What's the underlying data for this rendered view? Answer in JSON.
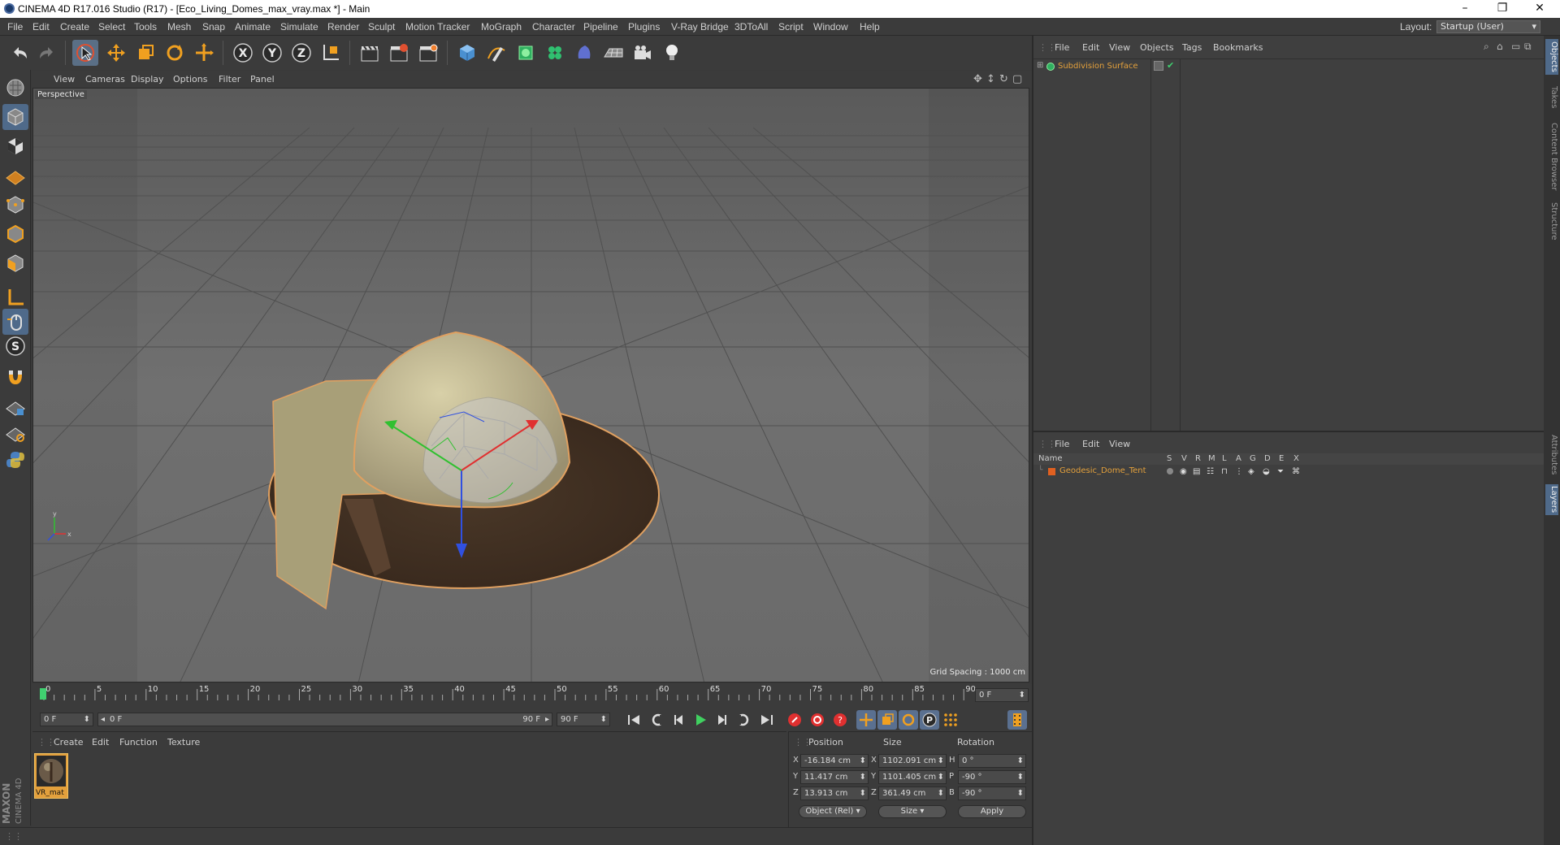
{
  "window": {
    "title": "CINEMA 4D R17.016 Studio (R17) - [Eco_Living_Domes_max_vray.max *] - Main",
    "minimize": "–",
    "restore": "❐",
    "close": "✕"
  },
  "menu": [
    "File",
    "Edit",
    "Create",
    "Select",
    "Tools",
    "Mesh",
    "Snap",
    "Animate",
    "Simulate",
    "Render",
    "Sculpt",
    "Motion Tracker",
    "MoGraph",
    "Character",
    "Pipeline",
    "Plugins",
    "V-Ray Bridge",
    "3DToAll",
    "Script",
    "Window",
    "Help"
  ],
  "layout": {
    "label": "Layout:",
    "value": "Startup (User)"
  },
  "viewport": {
    "menu": [
      "View",
      "Cameras",
      "Display",
      "Options",
      "Filter",
      "Panel"
    ],
    "label": "Perspective",
    "grid_spacing": "Grid Spacing : 1000 cm"
  },
  "timeline": {
    "ticks": [
      "0",
      "5",
      "10",
      "15",
      "20",
      "25",
      "30",
      "35",
      "40",
      "45",
      "50",
      "55",
      "60",
      "65",
      "70",
      "75",
      "80",
      "85",
      "90"
    ],
    "current_frame": "0 F"
  },
  "transport": {
    "start": "0 F",
    "range_start": "0 F",
    "range_end": "90 F",
    "end": "90 F"
  },
  "materials": {
    "menu": [
      "Create",
      "Edit",
      "Function",
      "Texture"
    ],
    "items": [
      {
        "name": "VR_mat"
      }
    ]
  },
  "coordinates": {
    "headers": {
      "position": "Position",
      "size": "Size",
      "rotation": "Rotation"
    },
    "rows": [
      {
        "axis": "X",
        "pos": "-16.184 cm",
        "size_axis": "X",
        "size": "1102.091 cm",
        "rot_axis": "H",
        "rot": "0 °"
      },
      {
        "axis": "Y",
        "pos": "11.417 cm",
        "size_axis": "Y",
        "size": "1101.405 cm",
        "rot_axis": "P",
        "rot": "-90 °"
      },
      {
        "axis": "Z",
        "pos": "13.913 cm",
        "size_axis": "Z",
        "size": "361.49 cm",
        "rot_axis": "B",
        "rot": "-90 °"
      }
    ],
    "mode": "Object (Rel)",
    "size_mode": "Size",
    "apply": "Apply"
  },
  "objects_panel": {
    "menu": [
      "File",
      "Edit",
      "View",
      "Objects",
      "Tags",
      "Bookmarks"
    ],
    "items": [
      {
        "name": "Subdivision Surface"
      }
    ]
  },
  "layers_panel": {
    "menu": [
      "File",
      "Edit",
      "View"
    ],
    "columns": [
      "Name",
      "S",
      "V",
      "R",
      "M",
      "L",
      "A",
      "G",
      "D",
      "E",
      "X"
    ],
    "items": [
      {
        "name": "Geodesic_Dome_Tent"
      }
    ]
  },
  "right_tabs": [
    "Objects",
    "Takes",
    "Content Browser",
    "Structure",
    "Attributes",
    "Layers"
  ],
  "brand": "MAXON CINEMA 4D",
  "colors": {
    "object_name": "#e3a03c",
    "active_tab": "#4f6a8a",
    "axis_x": "#e03030",
    "axis_y": "#30c030",
    "axis_z": "#3050e0"
  }
}
